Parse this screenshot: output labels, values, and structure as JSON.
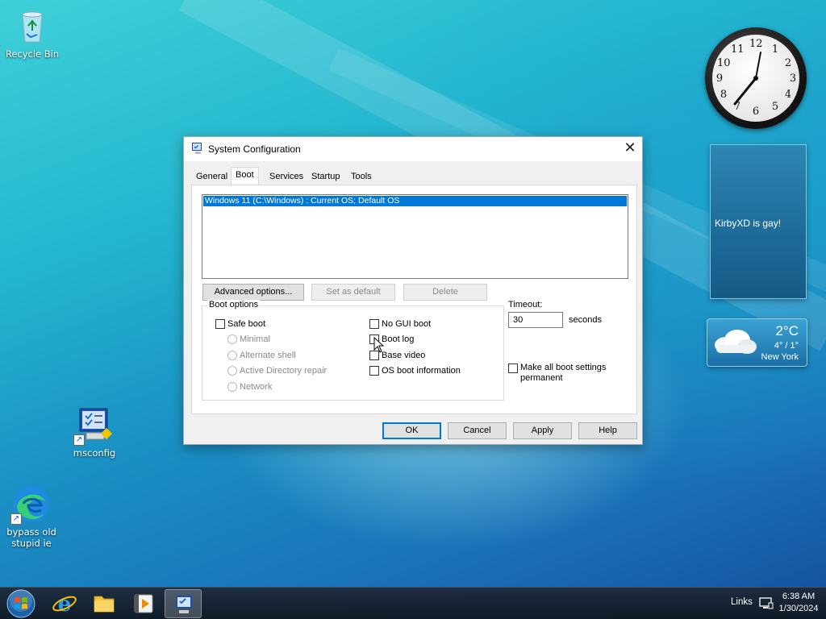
{
  "desktop": {
    "icons": [
      {
        "label": "Recycle Bin"
      },
      {
        "label": "msconfig"
      },
      {
        "label": "bypass old stupid ie"
      }
    ]
  },
  "gadgets": {
    "clock": {
      "numbers": [
        "12",
        "1",
        "2",
        "3",
        "4",
        "5",
        "6",
        "7",
        "8",
        "9",
        "10",
        "11"
      ]
    },
    "note": {
      "text": "KirbyXD is gay!"
    },
    "weather": {
      "temp": "2°C",
      "range": "4° / 1°",
      "city": "New York"
    }
  },
  "window": {
    "title": "System Configuration",
    "close_symbol": "✕",
    "tabs": [
      {
        "label": "General"
      },
      {
        "label": "Boot",
        "active": true
      },
      {
        "label": "Services"
      },
      {
        "label": "Startup"
      },
      {
        "label": "Tools"
      }
    ],
    "os_list": {
      "selected": "Windows 11 (C:\\Windows) : Current OS; Default OS"
    },
    "buttons": {
      "advanced": "Advanced options...",
      "set_default": "Set as default",
      "delete": "Delete"
    },
    "boot_options": {
      "legend": "Boot options",
      "safe_boot": "Safe boot",
      "minimal": "Minimal",
      "alternate_shell": "Alternate shell",
      "ad_repair": "Active Directory repair",
      "network": "Network",
      "no_gui": "No GUI boot",
      "boot_log": "Boot log",
      "base_video": "Base video",
      "os_info": "OS boot information"
    },
    "timeout": {
      "label": "Timeout:",
      "value": "30",
      "unit": "seconds"
    },
    "permanent": {
      "line1": "Make all boot settings",
      "line2": "permanent"
    },
    "footer": {
      "ok": "OK",
      "cancel": "Cancel",
      "apply": "Apply",
      "help": "Help"
    }
  },
  "taskbar": {
    "links": "Links",
    "time": "6:38 AM",
    "date": "1/30/2024"
  },
  "colors": {
    "selection": "#0078d7",
    "accent": "#0078d7"
  }
}
